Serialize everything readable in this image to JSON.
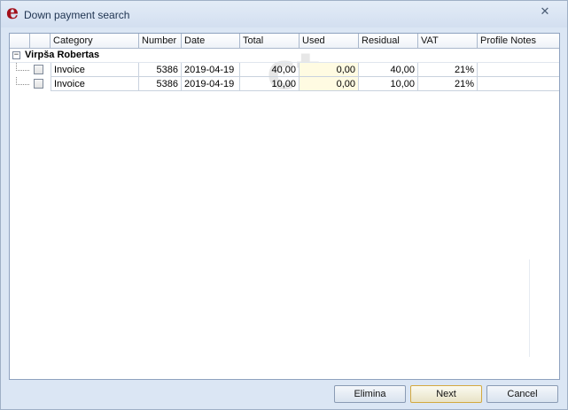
{
  "window": {
    "title": "Down payment search",
    "logo_letter": "e",
    "close_glyph": "✕"
  },
  "grid": {
    "columns": [
      "Category",
      "Number",
      "Date",
      "Total",
      "Used",
      "Residual",
      "VAT",
      "Profile Notes"
    ],
    "groups": [
      {
        "expander": "−",
        "label": "Virpša Robertas",
        "rows": [
          {
            "category": "Invoice",
            "number": "5386",
            "date": "2019-04-19",
            "total": "40,00",
            "used": "0,00",
            "residual": "40,00",
            "vat": "21%",
            "profile_notes": ""
          },
          {
            "category": "Invoice",
            "number": "5386",
            "date": "2019-04-19",
            "total": "10,00",
            "used": "0,00",
            "residual": "10,00",
            "vat": "21%",
            "profile_notes": ""
          }
        ]
      }
    ]
  },
  "footer": {
    "elimina_label": "Elimina",
    "next_label": "Next",
    "cancel_label": "Cancel"
  },
  "colors": {
    "title_text": "#1e3350",
    "logo": "#a3101a",
    "used_cell_bg": "#fffbe2",
    "window_bg": "#dbe6f4",
    "default_button_border": "#d3a940"
  }
}
